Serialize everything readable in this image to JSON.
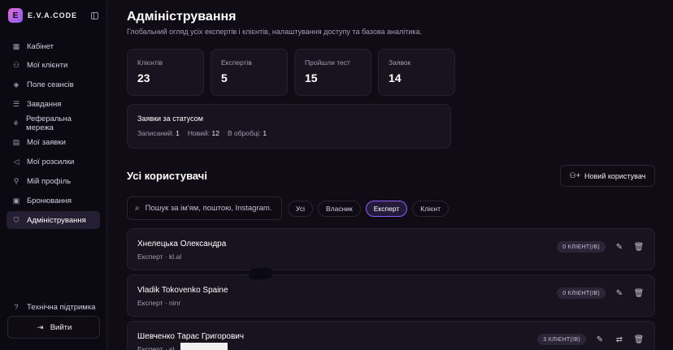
{
  "brand": {
    "name": "E.V.A.CODE",
    "logo_letter": "E"
  },
  "sidebar": {
    "items": [
      {
        "label": "Кабінет",
        "icon": "grid-icon",
        "glyph": "▦"
      },
      {
        "label": "Мої клієнти",
        "icon": "users-icon",
        "glyph": "⚇"
      },
      {
        "label": "Поле сеансів",
        "icon": "layers-icon",
        "glyph": "◈"
      },
      {
        "label": "Завдання",
        "icon": "checklist-icon",
        "glyph": "☰"
      },
      {
        "label": "Реферальна мережа",
        "icon": "network-icon",
        "glyph": "⚘"
      },
      {
        "label": "Мої заявки",
        "icon": "document-icon",
        "glyph": "▤"
      },
      {
        "label": "Мої розсилки",
        "icon": "megaphone-icon",
        "glyph": "◁"
      },
      {
        "label": "Мій профіль",
        "icon": "user-icon",
        "glyph": "⚲"
      },
      {
        "label": "Бронювання",
        "icon": "calendar-icon",
        "glyph": "▣"
      },
      {
        "label": "Адміністрування",
        "icon": "shield-icon",
        "glyph": "⛉",
        "active": true
      }
    ],
    "support_label": "Технічна підтримка",
    "logout_label": "Вийти"
  },
  "header": {
    "title": "Адміністрування",
    "subtitle": "Глобальний огляд усіх експертів і клієнтів, налаштування доступу та базова аналітика."
  },
  "stats": [
    {
      "label": "Клієнтів",
      "value": "23"
    },
    {
      "label": "Експертів",
      "value": "5"
    },
    {
      "label": "Пройшли тест",
      "value": "15"
    },
    {
      "label": "Заявок",
      "value": "14"
    }
  ],
  "status": {
    "title": "Заявки за статусом",
    "items": [
      {
        "label": "Записаний:",
        "value": "1"
      },
      {
        "label": "Новий:",
        "value": "12"
      },
      {
        "label": "В обробці:",
        "value": "1"
      }
    ]
  },
  "users_section": {
    "title": "Усі користувачі",
    "new_user_label": "Новий користувач",
    "search_placeholder": "Пошук за ім'ям, поштою, Instagram...",
    "filters": [
      {
        "label": "Усі",
        "active": false
      },
      {
        "label": "Власник",
        "active": false
      },
      {
        "label": "Експерт",
        "active": true
      },
      {
        "label": "Клієнт",
        "active": false
      }
    ],
    "users": [
      {
        "name": "Хнелецька Олександра",
        "meta": "Експерт · kl.al",
        "badge": "0 КЛІЄНТ(ІВ)",
        "transfer": false
      },
      {
        "name": "Vladik Tokovenko Spaine",
        "meta": "Експерт · ninr",
        "badge": "0 КЛІЄНТ(ІВ)",
        "transfer": false
      },
      {
        "name": "Шевченко Тарас Григорович",
        "meta": "Експерт · st",
        "badge": "3 КЛІЄНТ(ІВ)",
        "transfer": true
      }
    ]
  }
}
